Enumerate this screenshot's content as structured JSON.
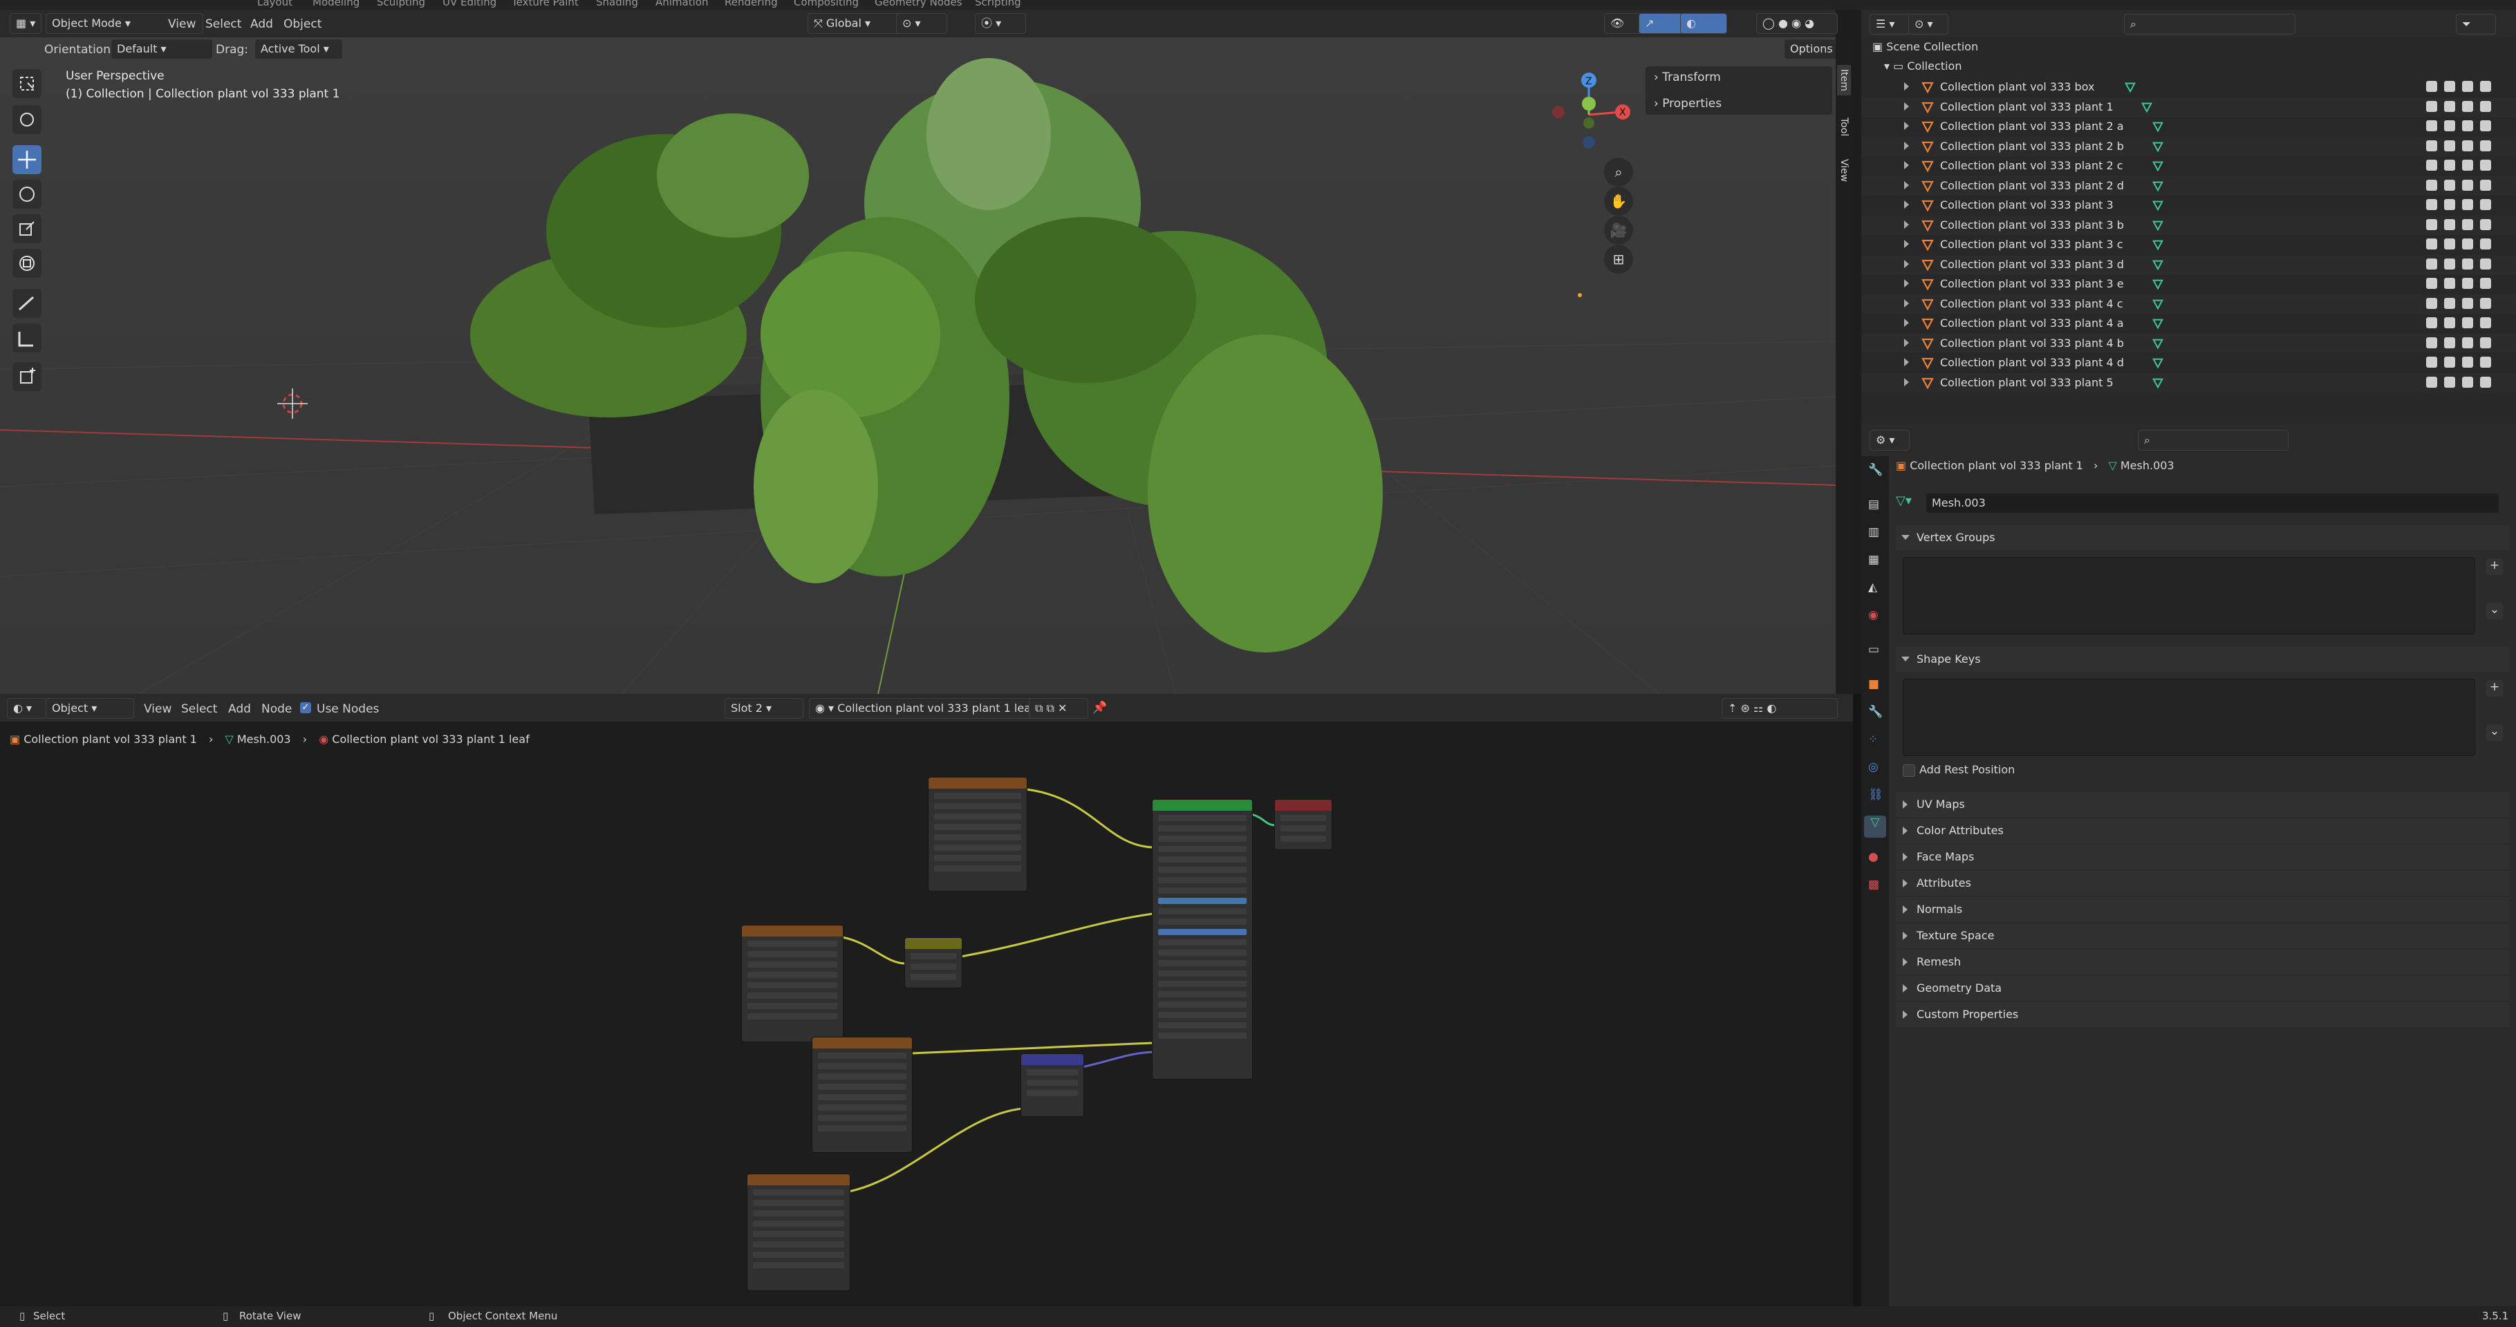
{
  "top_menu": [
    "Layout",
    "Modeling",
    "Sculpting",
    "UV Editing",
    "Texture Paint",
    "Shading",
    "Animation",
    "Rendering",
    "Compositing",
    "Geometry Nodes",
    "Scripting"
  ],
  "viewport": {
    "mode": "Object Mode",
    "menus": [
      "View",
      "Select",
      "Add",
      "Object"
    ],
    "transform_space": "Global",
    "orientation_label": "Orientation:",
    "orientation_value": "Default",
    "drag_label": "Drag:",
    "drag_value": "Active Tool",
    "options_label": "Options",
    "overlay_title": "User Perspective",
    "overlay_subtitle": "(1) Collection | Collection plant vol 333 plant 1",
    "npanel_items": [
      "Transform",
      "Properties"
    ],
    "npanel_tabs": [
      "Item",
      "Tool",
      "View"
    ],
    "gizmo_axes": [
      "Z",
      "Y",
      "X"
    ]
  },
  "outliner": {
    "scene_collection": "Scene Collection",
    "collection": "Collection",
    "items": [
      "Collection plant vol 333 box",
      "Collection plant vol 333 plant 1",
      "Collection plant vol 333 plant 2 a",
      "Collection plant vol 333 plant 2 b",
      "Collection plant vol 333 plant 2 c",
      "Collection plant vol 333 plant 2 d",
      "Collection plant vol 333 plant 3",
      "Collection plant vol 333 plant 3 b",
      "Collection plant vol 333 plant 3 c",
      "Collection plant vol 333 plant 3 d",
      "Collection plant vol 333 plant 3 e",
      "Collection plant vol 333 plant 4 c",
      "Collection plant vol 333 plant 4 a",
      "Collection plant vol 333 plant 4 b",
      "Collection plant vol 333 plant 4 d",
      "Collection plant vol 333 plant 5"
    ]
  },
  "properties": {
    "breadcrumb_object": "Collection plant vol 333 plant 1",
    "breadcrumb_mesh": "Mesh.003",
    "mesh_name": "Mesh.003",
    "panels_open": [
      "Vertex Groups",
      "Shape Keys"
    ],
    "add_rest_position": "Add Rest Position",
    "panels_closed": [
      "UV Maps",
      "Color Attributes",
      "Face Maps",
      "Attributes",
      "Normals",
      "Texture Space",
      "Remesh",
      "Geometry Data",
      "Custom Properties"
    ]
  },
  "node_editor": {
    "mode": "Object",
    "menus": [
      "View",
      "Select",
      "Add",
      "Node"
    ],
    "use_nodes": "Use Nodes",
    "slot": "Slot 2",
    "material": "Collection plant vol 333 plant 1 leaf",
    "breadcrumb": [
      "Collection plant vol 333 plant 1",
      "Mesh.003",
      "Collection plant vol 333 plant 1 leaf"
    ]
  },
  "statusbar": {
    "select": "Select",
    "rotate": "Rotate View",
    "context": "Object Context Menu",
    "version": "3.5.1"
  },
  "colors": {
    "accent": "#4772b3",
    "outliner_object": "#e8823a",
    "mesh_data": "#3fc79b",
    "x_axis": "#e44a4a",
    "y_axis": "#8bc34a",
    "z_axis": "#4a90e4"
  }
}
